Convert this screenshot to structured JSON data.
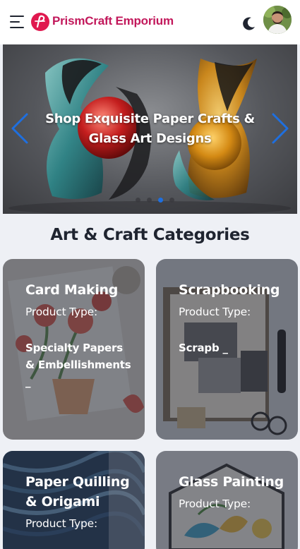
{
  "header": {
    "brand_name": "PrismCraft Emporium",
    "brand_color": "#c2185b",
    "icons": [
      "menu-icon",
      "logo-icon",
      "moon-icon",
      "avatar"
    ]
  },
  "hero": {
    "title": "Shop Exquisite Paper Crafts & Glass Art Designs",
    "slides_total": 4,
    "active_slide": 3
  },
  "categories": {
    "heading": "Art & Craft Categories",
    "items": [
      {
        "title": "Card Making",
        "subtitle": "Product Type:",
        "tags": "Specialty Papers & Embellishments _"
      },
      {
        "title": "Scrapbooking",
        "subtitle": "Product Type:",
        "tags": "Scrapb _"
      },
      {
        "title": "Paper Quilling & Origami",
        "subtitle": "Product Type:",
        "tags": ""
      },
      {
        "title": "Glass Painting",
        "subtitle": "Product Type:",
        "tags": ""
      }
    ]
  },
  "colors": {
    "accent": "#1e6fe0",
    "logo": "#e0194f"
  }
}
